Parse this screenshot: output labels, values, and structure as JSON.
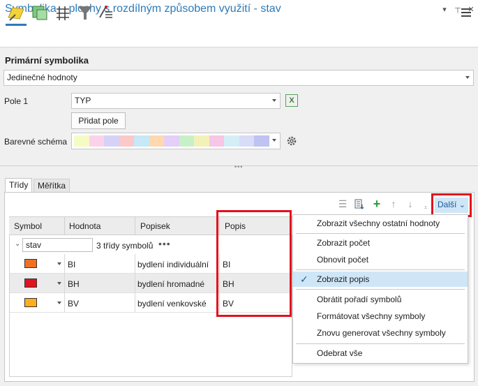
{
  "window": {
    "title": "Symbolika – plochy s rozdílným způsobem využití - stav",
    "menu_glyph": "▾",
    "pin_glyph": "⊥",
    "close_glyph": "✕"
  },
  "toolbar": {
    "tools": [
      "primary-symbology-icon",
      "vary-symbology-icon",
      "symbol-layers-icon",
      "filter-icon",
      "advanced-symbology-icon"
    ],
    "menu_icon": "hamburger-icon"
  },
  "primary": {
    "heading": "Primární symbolika",
    "method": "Jedinečné hodnoty"
  },
  "field": {
    "label": "Pole 1",
    "value": "TYP",
    "expression_icon": "X",
    "add_label": "Přidat pole"
  },
  "scheme": {
    "label": "Barevné schéma",
    "colors": [
      "#f5fbc4",
      "#fbd3e8",
      "#d6d2f7",
      "#fbc9c9",
      "#c6e8f7",
      "#ffd8b0",
      "#e3cff7",
      "#c8f0c8",
      "#f2f2b8",
      "#f7c6e6",
      "#d4eef7",
      "#d8dcf7",
      "#bec3f2"
    ]
  },
  "tabs": {
    "classes": "Třídy",
    "scales": "Měřítka"
  },
  "more": {
    "label": "Další",
    "caret": "⌄"
  },
  "table": {
    "headers": [
      "Symbol",
      "Hodnota",
      "Popisek",
      "Popis"
    ],
    "group": {
      "chevron": "⌄",
      "name": "stav",
      "count": "3 třídy symbolů",
      "dots": "•••"
    },
    "rows": [
      {
        "color": "#f07020",
        "value": "BI",
        "label": "bydlení individuální",
        "description": "BI"
      },
      {
        "color": "#e0141e",
        "value": "BH",
        "label": "bydlení hromadné",
        "description": "BH"
      },
      {
        "color": "#ffae1e",
        "value": "BV",
        "label": "bydlení venkovské",
        "description": "BV"
      }
    ]
  },
  "menu": {
    "items": [
      "Zobrazit všechny ostatní hodnoty",
      "Zobrazit počet",
      "Obnovit počet",
      "Zobrazit popis",
      "Obrátit pořadí symbolů",
      "Formátovat všechny symboly",
      "Znovu generovat všechny symboly",
      "Odebrat vše"
    ],
    "check_glyph": "✓"
  },
  "colors": {
    "accent": "#2d7ab8",
    "highlight_red": "#e2121b",
    "selected_bg": "#cfe6f7"
  }
}
